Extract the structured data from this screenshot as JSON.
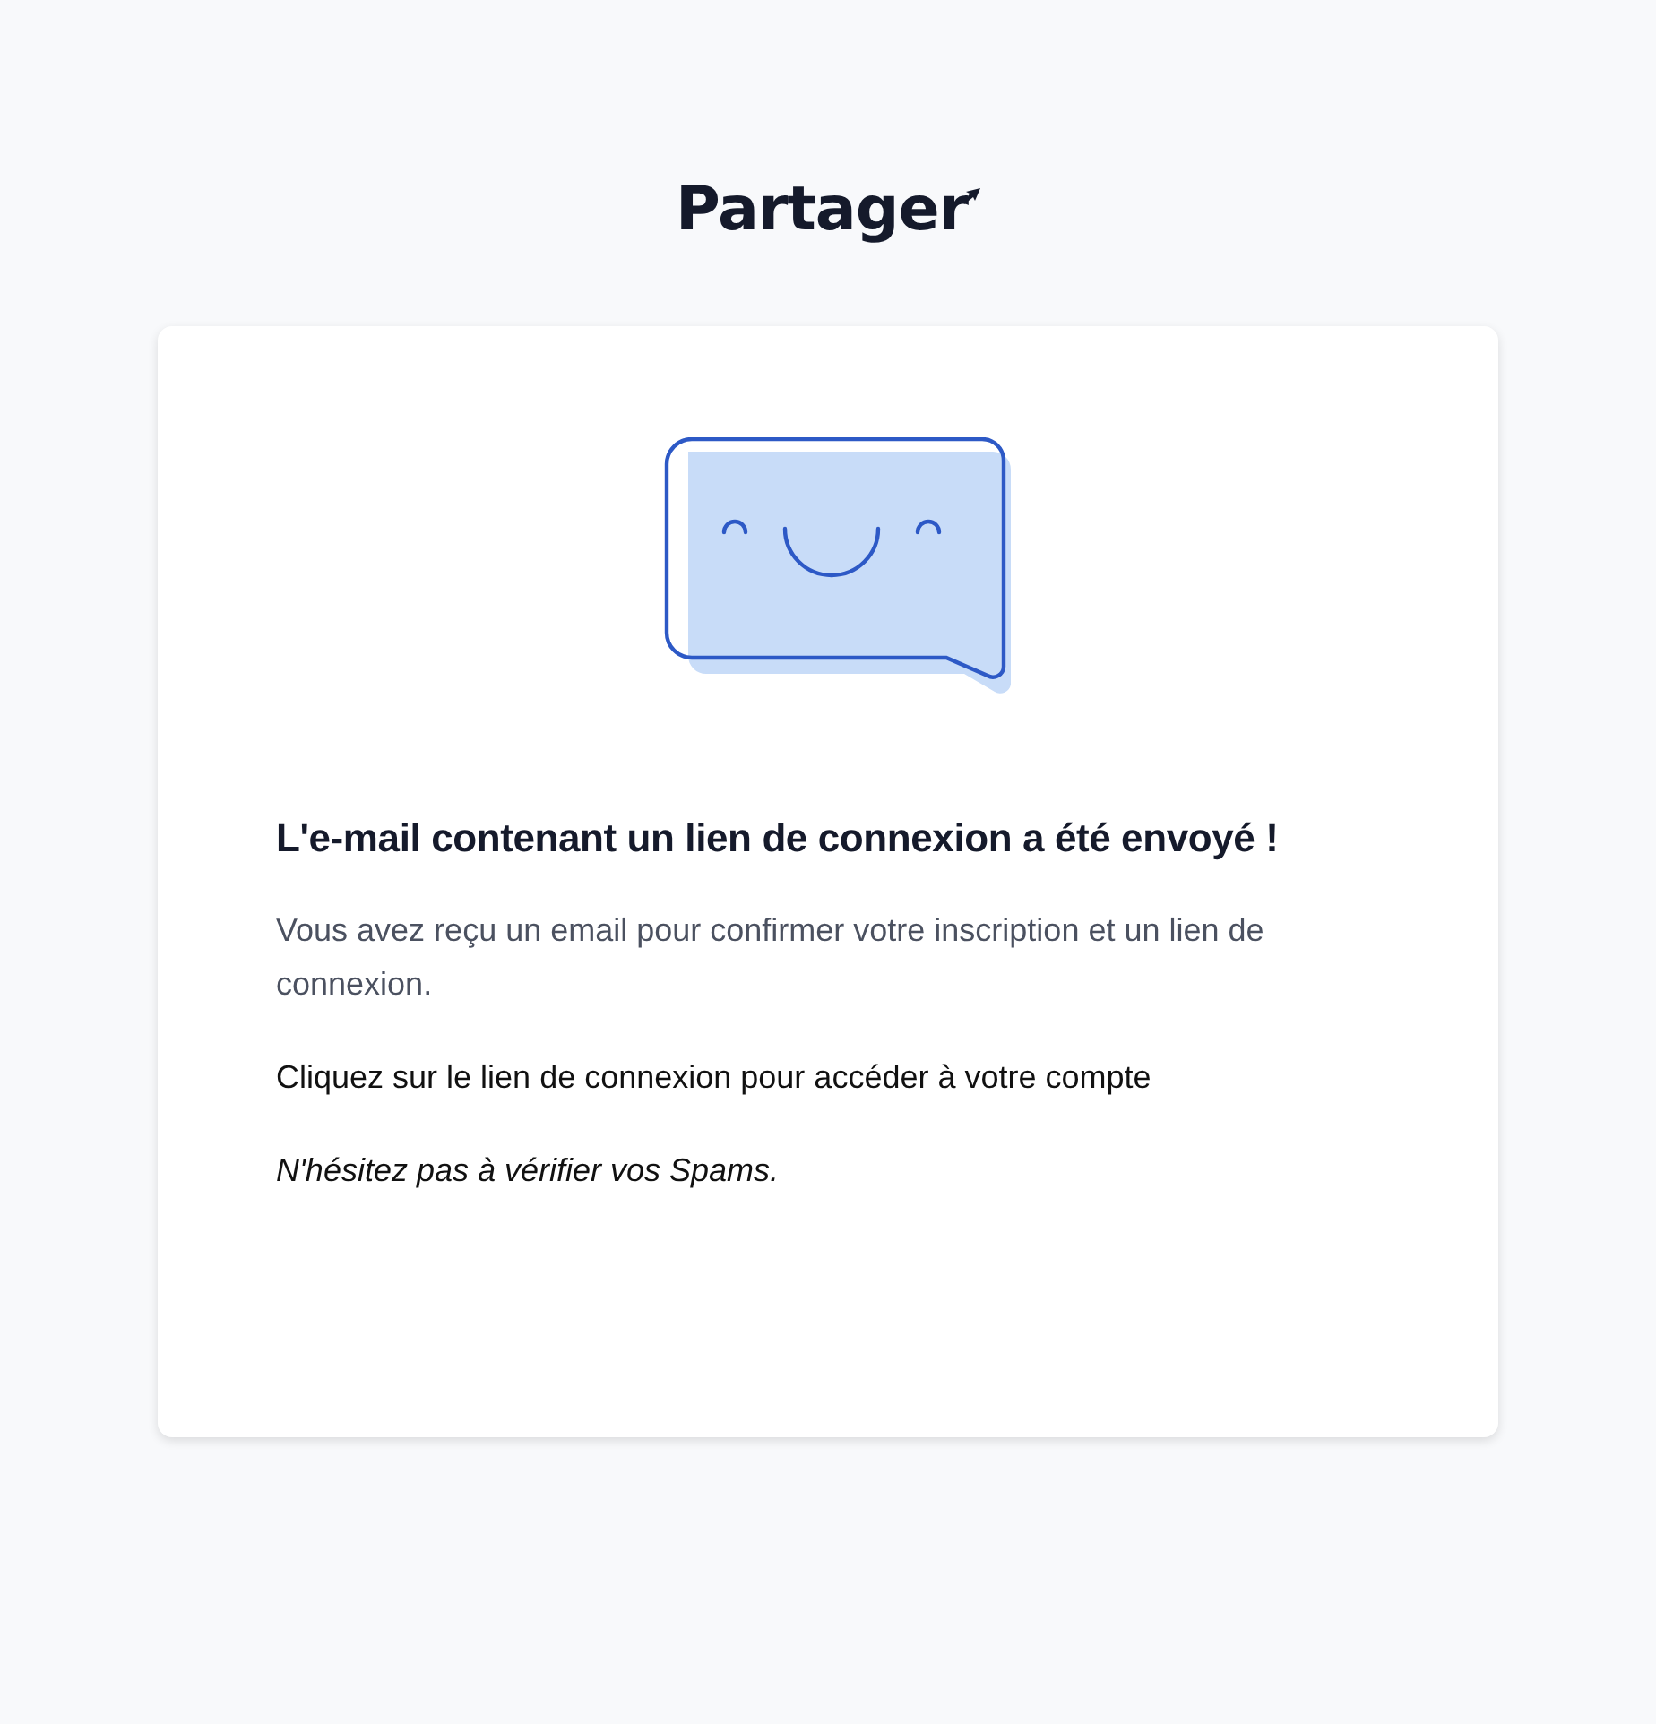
{
  "logo": {
    "text": "Partager"
  },
  "card": {
    "heading": "L'e-mail contenant un lien de connexion a été envoyé !",
    "paragraphs": [
      {
        "text": "Vous avez reçu un email pour confirmer votre inscription et un lien de connexion.",
        "kind": "muted"
      },
      {
        "text": "Cliquez sur le lien de connexion pour accéder à votre compte",
        "kind": "plain"
      },
      {
        "text": "N'hésitez pas à vérifier vos Spams.",
        "kind": "italic"
      }
    ]
  }
}
